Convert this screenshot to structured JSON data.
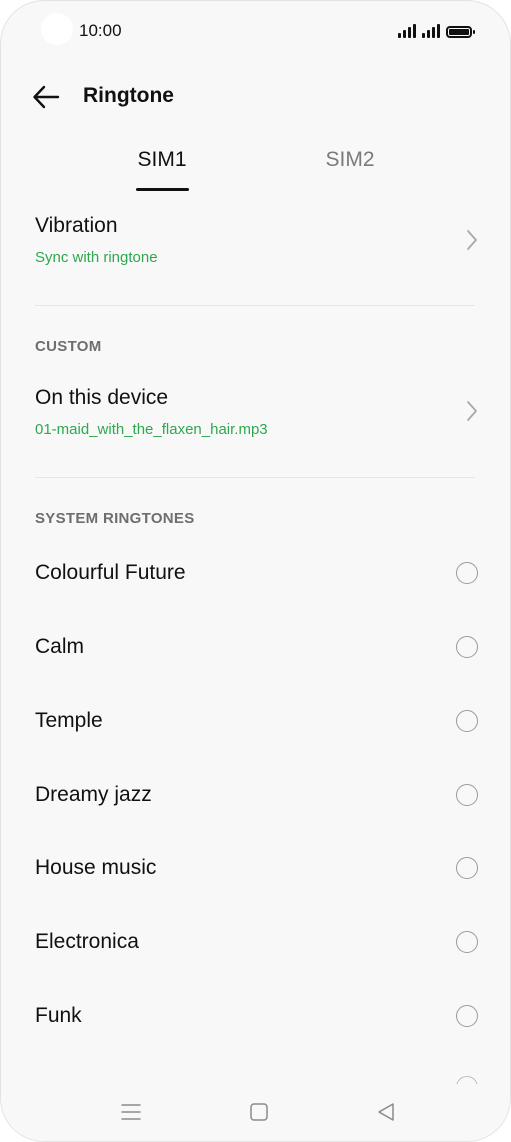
{
  "status_bar": {
    "time": "10:00"
  },
  "header": {
    "title": "Ringtone",
    "back_icon": "arrow-left-icon"
  },
  "tabs": [
    {
      "label": "SIM1",
      "selected": true
    },
    {
      "label": "SIM2",
      "selected": false
    }
  ],
  "vibration": {
    "title": "Vibration",
    "subtitle": "Sync with ringtone"
  },
  "custom": {
    "header": "CUSTOM",
    "item": {
      "title": "On this device",
      "subtitle": "01-maid_with_the_flaxen_hair.mp3"
    }
  },
  "system": {
    "header": "SYSTEM RINGTONES",
    "items": [
      {
        "label": "Colourful Future",
        "selected": false
      },
      {
        "label": "Calm",
        "selected": false
      },
      {
        "label": "Temple",
        "selected": false
      },
      {
        "label": "Dreamy jazz",
        "selected": false
      },
      {
        "label": "House music",
        "selected": false
      },
      {
        "label": "Electronica",
        "selected": false
      },
      {
        "label": "Funk",
        "selected": false
      }
    ]
  },
  "colors": {
    "accent": "#2ea84f",
    "text": "#111111",
    "secondary": "#7a7a7a",
    "background": "#f8f8f8"
  },
  "nav_bar": {
    "icons": [
      "menu-icon",
      "home-icon",
      "back-triangle-icon"
    ]
  }
}
